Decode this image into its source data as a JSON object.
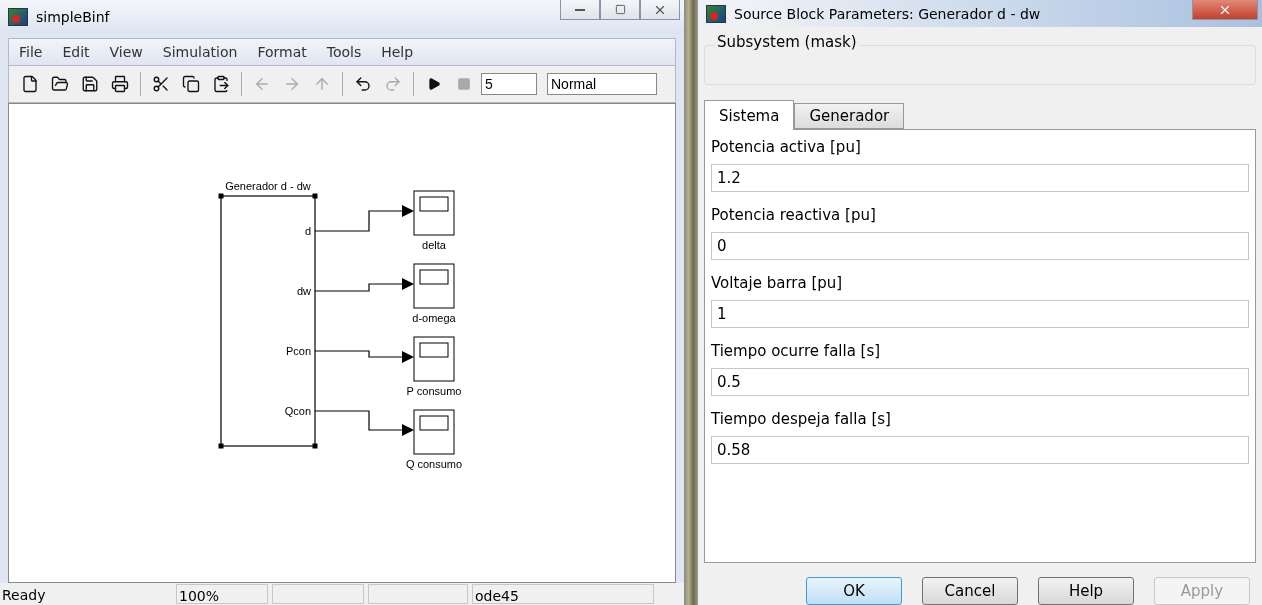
{
  "model_window": {
    "title": "simpleBinf",
    "menu": [
      "File",
      "Edit",
      "View",
      "Simulation",
      "Format",
      "Tools",
      "Help"
    ],
    "toolbar": [
      [
        {
          "kind": "new",
          "disabled": false
        },
        {
          "kind": "open",
          "disabled": false
        },
        {
          "kind": "save",
          "disabled": false
        },
        {
          "kind": "print",
          "disabled": false
        }
      ],
      [
        {
          "kind": "cut",
          "disabled": false
        },
        {
          "kind": "copy",
          "disabled": false
        },
        {
          "kind": "paste",
          "disabled": false
        }
      ],
      [
        {
          "kind": "back",
          "disabled": true
        },
        {
          "kind": "forward",
          "disabled": true
        },
        {
          "kind": "up",
          "disabled": true
        }
      ],
      [
        {
          "kind": "undo",
          "disabled": false
        },
        {
          "kind": "redo",
          "disabled": true
        }
      ],
      [
        {
          "kind": "start",
          "disabled": false
        },
        {
          "kind": "stop",
          "disabled": true
        }
      ]
    ],
    "stop_time": "5",
    "sim_mode": "Normal",
    "diagram": {
      "block_title": "Generador d - dw",
      "outputs": [
        {
          "port": "d",
          "scope": "delta"
        },
        {
          "port": "dw",
          "scope": "d-omega"
        },
        {
          "port": "Pcon",
          "scope": "P consumo"
        },
        {
          "port": "Qcon",
          "scope": "Q consumo"
        }
      ]
    },
    "status_bar": {
      "state": "Ready",
      "zoom": "100%",
      "solver": "ode45"
    }
  },
  "dialog": {
    "title": "Source Block Parameters: Generador d - dw",
    "group": "Subsystem (mask)",
    "tabs": [
      {
        "label": "Sistema",
        "selected": true
      },
      {
        "label": "Generador",
        "selected": false
      }
    ],
    "params": [
      {
        "label": "Potencia activa [pu]",
        "value": "1.2"
      },
      {
        "label": "Potencia reactiva [pu]",
        "value": "0"
      },
      {
        "label": "Voltaje barra [pu]",
        "value": "1"
      },
      {
        "label": "Tiempo ocurre falla [s]",
        "value": "0.5"
      },
      {
        "label": "Tiempo despeja falla [s]",
        "value": "0.58"
      }
    ],
    "buttons": [
      {
        "label": "OK",
        "default": true,
        "disabled": false
      },
      {
        "label": "Cancel",
        "default": false,
        "disabled": false
      },
      {
        "label": "Help",
        "default": false,
        "disabled": false
      },
      {
        "label": "Apply",
        "default": false,
        "disabled": true
      }
    ]
  }
}
